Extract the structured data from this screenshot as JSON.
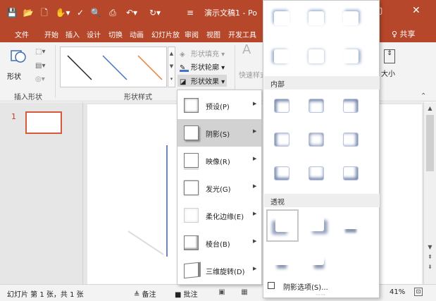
{
  "quick_access": [
    "save-icon",
    "open-icon",
    "new-icon",
    "touch-mode-icon",
    "spelling-icon",
    "preview-icon",
    "print-preview-icon",
    "undo-icon",
    "redo-icon",
    "customize-icon"
  ],
  "window": {
    "title": "演示文稿1 - Po",
    "minimize": "▢",
    "close": "✕"
  },
  "tabs": [
    "文件",
    "开始",
    "插入",
    "设计",
    "切换",
    "动画",
    "幻灯片放",
    "审阅",
    "视图",
    "开发工具"
  ],
  "share_label": "♀ 共享",
  "ribbon": {
    "insert_shapes": {
      "button_label": "形状",
      "group_label": "插入形状"
    },
    "shape_styles": {
      "group_label": "形状样式",
      "fill_label": "形状填充",
      "outline_label": "形状轮廓",
      "effects_label": "形状效果"
    },
    "quick_styles_label": "快速样式",
    "size_label": "大小"
  },
  "thumbnails": [
    {
      "number": "1"
    }
  ],
  "effects_menu": {
    "items": [
      {
        "label": "预设(P)",
        "active": false
      },
      {
        "label": "阴影(S)",
        "active": true
      },
      {
        "label": "映像(R)",
        "active": false
      },
      {
        "label": "发光(G)",
        "active": false
      },
      {
        "label": "柔化边缘(E)",
        "active": false
      },
      {
        "label": "棱台(B)",
        "active": false
      },
      {
        "label": "三维旋转(D)",
        "active": false
      }
    ]
  },
  "shadow_submenu": {
    "sections": [
      {
        "label": ""
      },
      {
        "label": "内部"
      },
      {
        "label": "透视"
      }
    ],
    "options_label": "阴影选项(S)..."
  },
  "statusbar": {
    "slide_info": "幻灯片 第 1 张，共 1 张",
    "notes_label": "≜ 备注",
    "comments_label": "■ 批注",
    "zoom": "41%"
  },
  "colors": {
    "accent": "#b7472a",
    "active_item": "#d2d2d2"
  }
}
